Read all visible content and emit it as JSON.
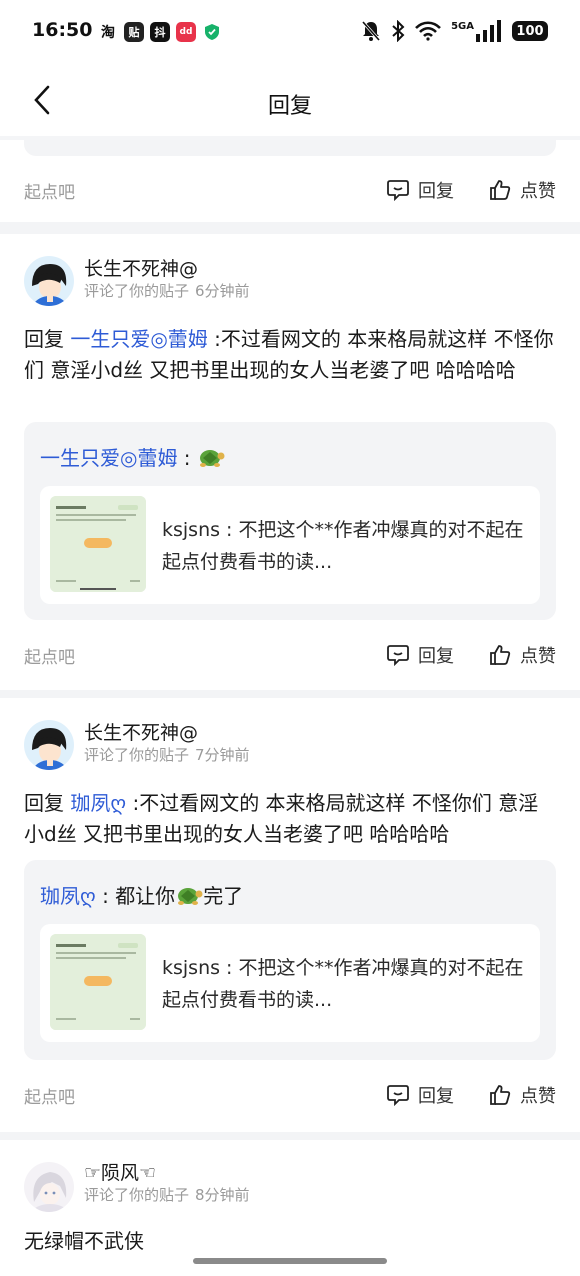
{
  "status_bar": {
    "time": "16:50",
    "app_icons": [
      "淘",
      "贴",
      "抖",
      "dd",
      "盾"
    ],
    "network": "5GA",
    "battery": "100"
  },
  "nav": {
    "title": "回复"
  },
  "feed": {
    "source": "起点吧",
    "reply_label": "回复",
    "like_label": "点赞",
    "comments": [
      {
        "user": "长生不死神@",
        "action": "评论了你的贴子",
        "time": "6分钟前",
        "reply_prefix": "回复",
        "mention": "一生只爱◎蕾姆",
        "body": " :不过看网文的 本来格局就这样 不怪你们 意淫小d丝 又把书里出现的女人当老婆了吧 哈哈哈哈",
        "quote_name": "一生只爱◎蕾姆",
        "quote_sep": " : ",
        "quote_text": "",
        "quote_text2": "",
        "card_text": "ksjsns : 不把这个**作者冲爆真的对不起在起点付费看书的读..."
      },
      {
        "user": "长生不死神@",
        "action": "评论了你的贴子",
        "time": "7分钟前",
        "reply_prefix": "回复",
        "mention": "珈夙ღ",
        "body": " :不过看网文的 本来格局就这样 不怪你们 意淫小d丝 又把书里出现的女人当老婆了吧 哈哈哈哈",
        "quote_name": "珈夙ღ",
        "quote_sep": " : ",
        "quote_text": "都让你",
        "quote_text2": "完了",
        "card_text": "ksjsns : 不把这个**作者冲爆真的对不起在起点付费看书的读..."
      },
      {
        "user": "☞陨风☜",
        "action": "评论了你的贴子",
        "time": "8分钟前",
        "body": "无绿帽不武侠"
      }
    ]
  },
  "colors": {
    "mention": "#2e5bd6",
    "muted": "#9a9a9a",
    "band": "#f3f4f6"
  },
  "icons": [
    "back-chevron-icon",
    "reply-bubble-icon",
    "thumbs-up-icon",
    "turtle-emoji-icon",
    "mute-bell-icon",
    "bluetooth-icon",
    "wifi-icon",
    "signal-icon"
  ]
}
